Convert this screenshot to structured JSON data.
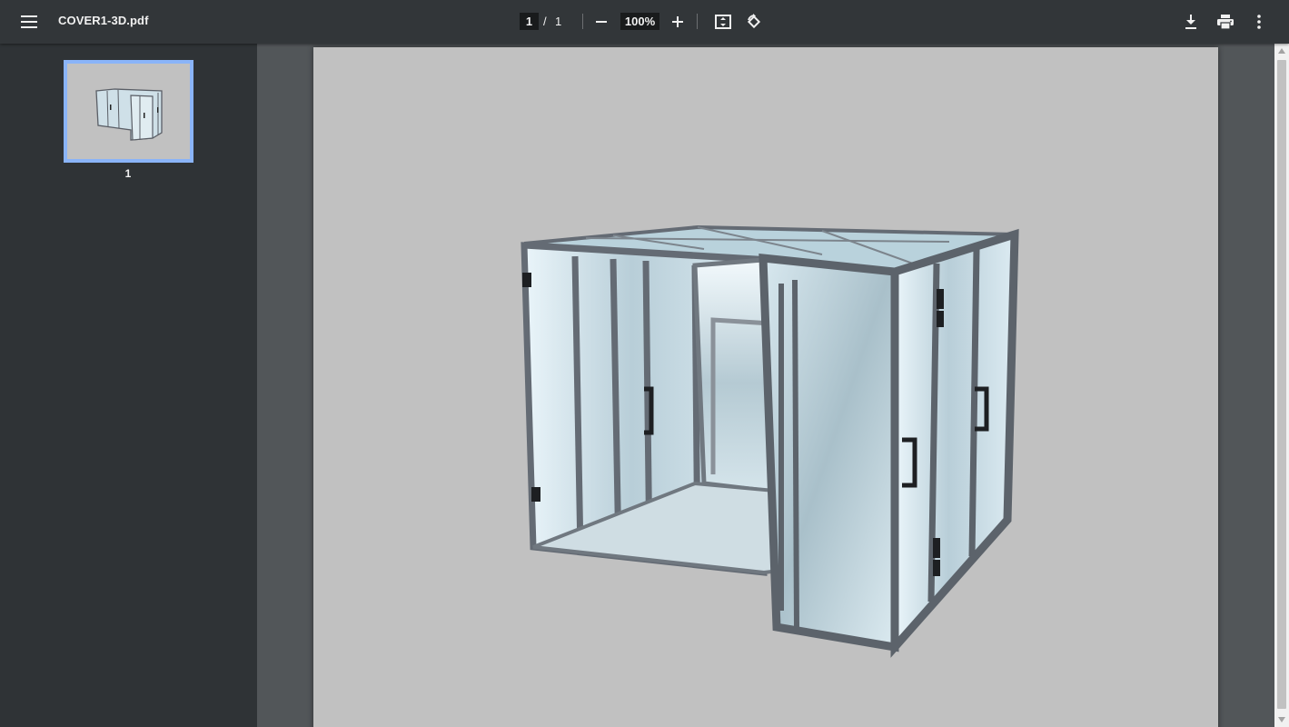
{
  "toolbar": {
    "file_name": "COVER1-3D.pdf",
    "current_page": "1",
    "page_separator": "/",
    "total_pages": "1",
    "zoom": "100%",
    "icons": {
      "menu": "hamburger-menu-icon",
      "zoom_out": "minus-icon",
      "zoom_in": "plus-icon",
      "fit": "fit-to-page-icon",
      "rotate": "rotate-counterclockwise-icon",
      "download": "download-icon",
      "print": "print-icon",
      "more": "more-vertical-icon"
    }
  },
  "sidebar": {
    "thumbnails": [
      {
        "label": "1",
        "selected": true
      }
    ]
  },
  "document": {
    "page_content": "3D rendering of a glass enclosure cabin with aluminum frame and double doors"
  },
  "colors": {
    "toolbar_bg": "#323639",
    "sidebar_bg": "#2f3336",
    "viewer_bg": "#525659",
    "page_bg": "#c1c1c1",
    "selection": "#8ab4f8"
  }
}
